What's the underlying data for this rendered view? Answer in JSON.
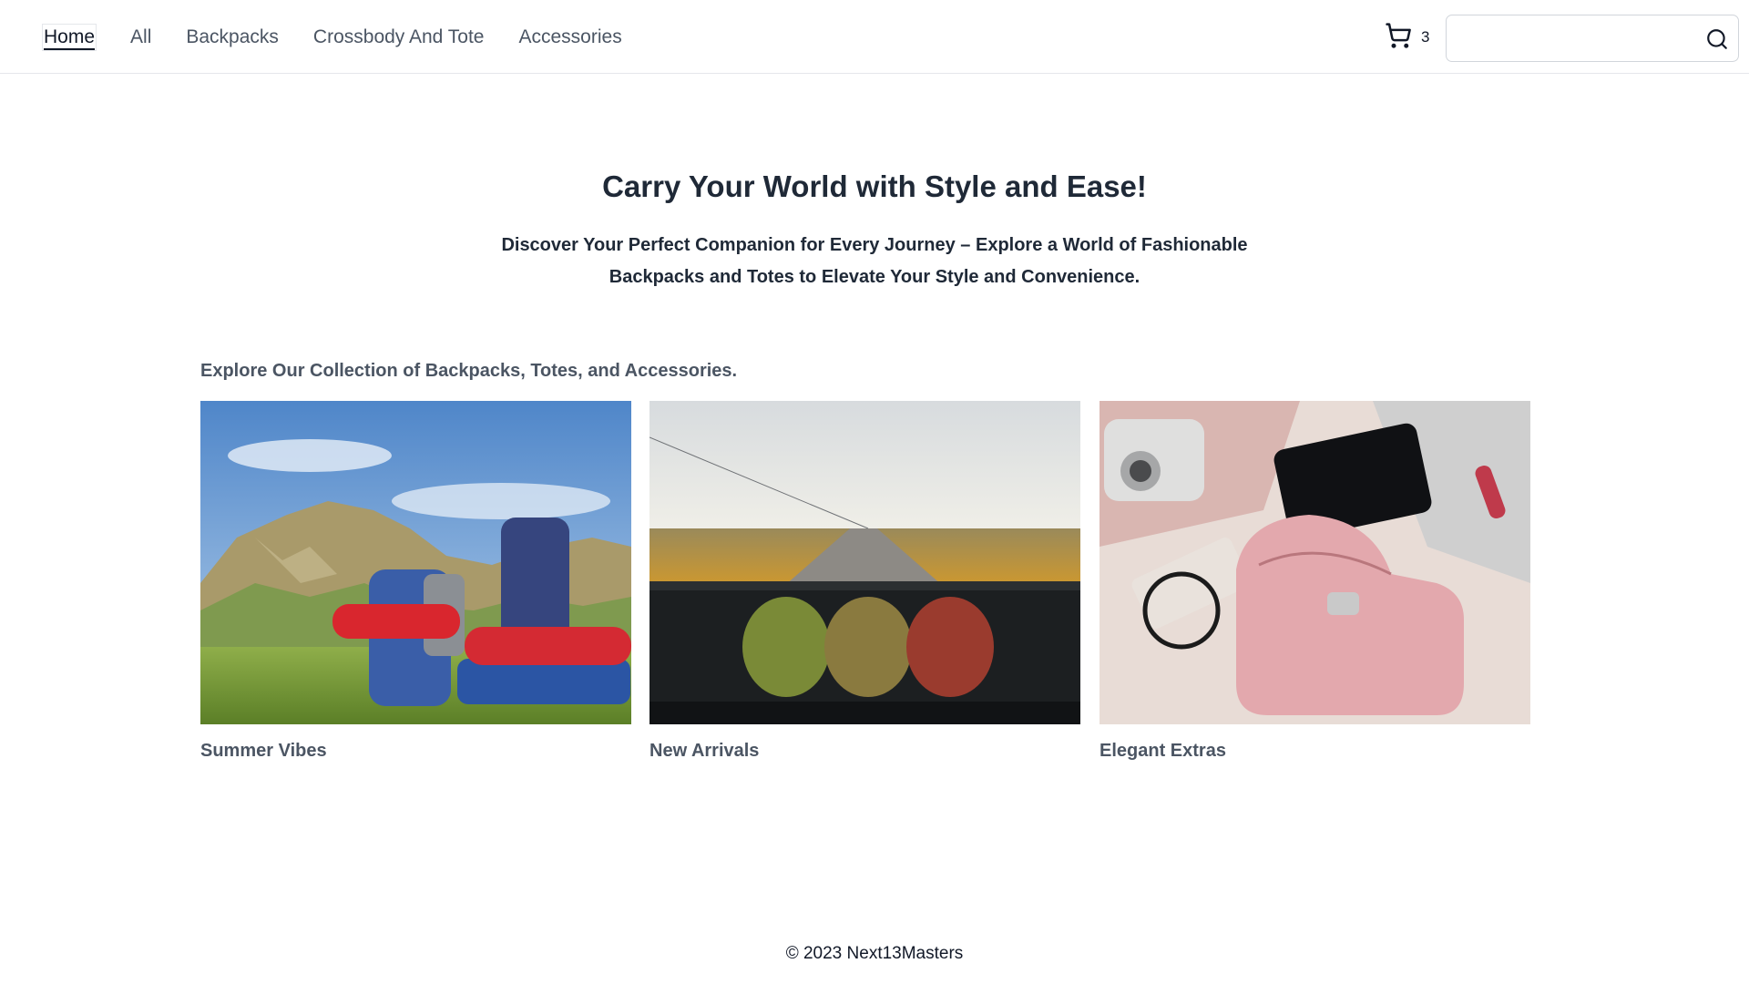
{
  "nav": {
    "links": [
      "Home",
      "All",
      "Backpacks",
      "Crossbody And Tote",
      "Accessories"
    ],
    "active": "Home"
  },
  "cart": {
    "icon": "cart-icon",
    "count": "3"
  },
  "search": {
    "placeholder": "",
    "icon": "search-icon"
  },
  "hero": {
    "title": "Carry Your World with Style and Ease!",
    "subtitle": "Discover Your Perfect Companion for Every Journey – Explore a World of Fashionable Backpacks and Totes to Elevate Your Style and Convenience."
  },
  "collection": {
    "heading": "Explore Our Collection of Backpacks, Totes, and Accessories.",
    "cards": [
      {
        "caption": "Summer Vibes"
      },
      {
        "caption": "New Arrivals"
      },
      {
        "caption": "Elegant Extras"
      }
    ]
  },
  "footer": {
    "text": "© 2023 Next13Masters"
  },
  "colors": {
    "text": "#111827",
    "muted": "#4b5563",
    "border": "#e5e7eb"
  }
}
